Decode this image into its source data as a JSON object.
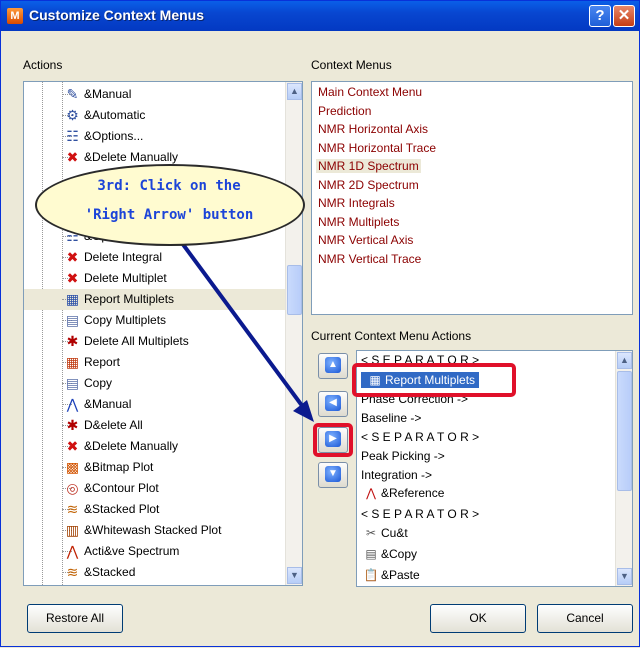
{
  "window": {
    "title": "Customize Context Menus",
    "help_glyph": "?",
    "close_glyph": "✕"
  },
  "actions": {
    "label": "Actions",
    "items": [
      {
        "label": "&Manual",
        "icon": "manual-icon"
      },
      {
        "label": "&Automatic",
        "icon": "automatic-icon"
      },
      {
        "label": "&Options...",
        "icon": "options-icon"
      },
      {
        "label": "&Delete Manually",
        "icon": "delete-manually-icon"
      },
      {
        "label": "&Options...",
        "icon": "options-icon"
      },
      {
        "label": "Delete Integral",
        "icon": "red-x-icon"
      },
      {
        "label": "Delete Multiplet",
        "icon": "red-x-icon"
      },
      {
        "label": "Report Multiplets",
        "icon": "report-multiplets-icon"
      },
      {
        "label": "Copy Multiplets",
        "icon": "copy-multiplets-icon"
      },
      {
        "label": "Delete All Multiplets",
        "icon": "delete-all-icon"
      },
      {
        "label": "Report",
        "icon": "report-icon"
      },
      {
        "label": "Copy",
        "icon": "copy-icon"
      },
      {
        "label": "&Manual",
        "icon": "peak-manual-icon"
      },
      {
        "label": "D&elete All",
        "icon": "delete-all-icon"
      },
      {
        "label": "&Delete Manually",
        "icon": "delete-manually-icon"
      },
      {
        "label": "&Bitmap Plot",
        "icon": "bitmap-plot-icon"
      },
      {
        "label": "&Contour Plot",
        "icon": "contour-plot-icon"
      },
      {
        "label": "&Stacked Plot",
        "icon": "stacked-plot-icon"
      },
      {
        "label": "&Whitewash Stacked Plot",
        "icon": "whitewash-plot-icon"
      },
      {
        "label": "Acti&ve Spectrum",
        "icon": "active-spectrum-icon"
      },
      {
        "label": "&Stacked",
        "icon": "stacked-icon"
      }
    ]
  },
  "context_menus": {
    "label": "Context Menus",
    "items": [
      "Main Context Menu",
      "Prediction",
      "NMR Horizontal Axis",
      "NMR Horizontal Trace",
      "NMR 1D Spectrum",
      "NMR 2D Spectrum",
      "NMR Integrals",
      "NMR Multiplets",
      "NMR Vertical Axis",
      "NMR Vertical Trace"
    ],
    "selected": "NMR 1D Spectrum"
  },
  "current_actions": {
    "label": "Current Context Menu Actions",
    "items": [
      "< S E P A R A T O R >",
      "Report Multiplets",
      "Phase Correction ->",
      "Baseline ->",
      "< S E P A R A T O R >",
      "Peak Picking ->",
      "Integration ->",
      "&Reference",
      "< S E P A R A T O R >",
      "Cu&t",
      "&Copy",
      "&Paste"
    ],
    "selected": "Report Multiplets"
  },
  "move_buttons": {
    "up": "▲",
    "left": "◀",
    "right": "▶",
    "down": "▼"
  },
  "callout": {
    "line1": "3rd: Click on the",
    "line2": "'Right Arrow' button"
  },
  "buttons": {
    "restore_all": "Restore All",
    "ok": "OK",
    "cancel": "Cancel"
  },
  "colors": {
    "context_menu_text": "#8b0000",
    "selection": "#316ac5",
    "highlight_frame": "#e0102a",
    "arrow": "#0b1a8f"
  }
}
